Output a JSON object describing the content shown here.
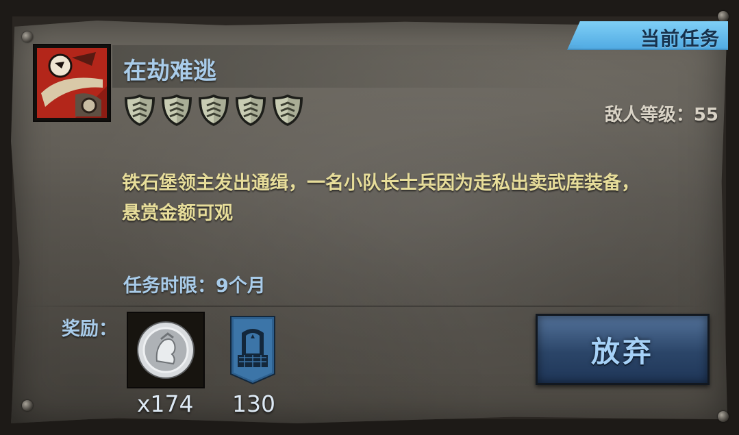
{
  "tag": {
    "label": "当前任务"
  },
  "quest": {
    "title": "在劫难逃",
    "difficulty_stars": 5,
    "enemy_level_label": "敌人等级：55",
    "description_line1": "铁石堡领主发出通缉，一名小队长士兵因为走私出卖武库装备，",
    "description_line2": "悬赏金额可观",
    "time_limit_label": "任务时限：9个月"
  },
  "rewards": {
    "label": "奖励：",
    "items": [
      {
        "icon": "silver-coin-icon",
        "amount": "x174"
      },
      {
        "icon": "castle-banner-icon",
        "amount": "130"
      }
    ]
  },
  "buttons": {
    "abandon": "放弃"
  },
  "colors": {
    "accent_blue": "#a9ccea",
    "description_yellow": "#e7dd9a",
    "tag_blue": "#4fa9e2",
    "button_blue": "#2b4568"
  }
}
